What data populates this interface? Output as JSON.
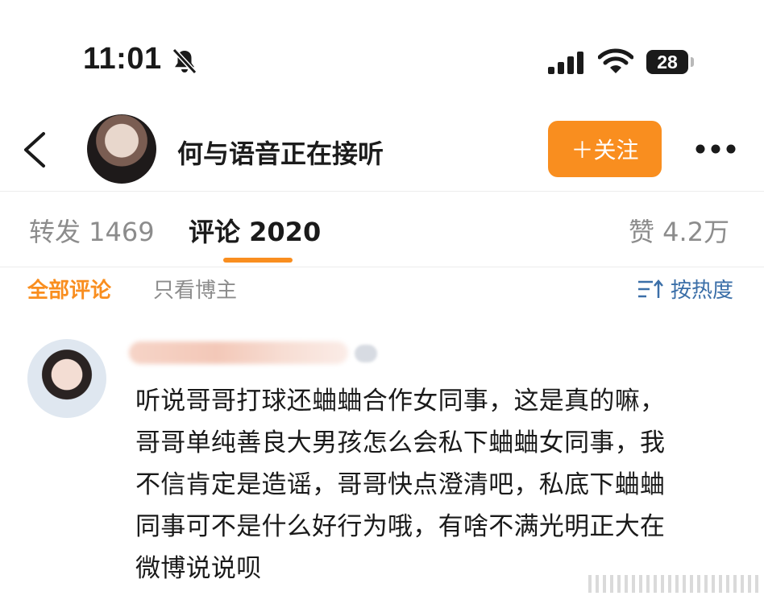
{
  "status_bar": {
    "time": "11:01",
    "battery": "28",
    "icons": [
      "bell-slash-icon",
      "signal-icon",
      "wifi-icon",
      "battery-icon"
    ]
  },
  "header": {
    "title": "何与语音正在接听",
    "follow_label": "＋关注",
    "icons": [
      "back-icon",
      "more-icon"
    ]
  },
  "tabs": {
    "repost": "转发 1469",
    "comments": "评论 2020",
    "likes": "赞 4.2万"
  },
  "filters": {
    "all": "全部评论",
    "owner_only": "只看博主",
    "sort": "按热度"
  },
  "comment": {
    "text": "听说哥哥打球还蛐蛐合作女同事，这是真的嘛，\n哥哥单纯善良大男孩怎么会私下蛐蛐女同事，我\n不信肯定是造谣，哥哥快点澄清吧，私底下蛐蛐\n同事可不是什么好行为哦，有啥不满光明正大在\n微博说说呗"
  },
  "colors": {
    "accent": "#f98e1f",
    "link": "#3b6fa8",
    "muted": "#8c8c8c"
  }
}
